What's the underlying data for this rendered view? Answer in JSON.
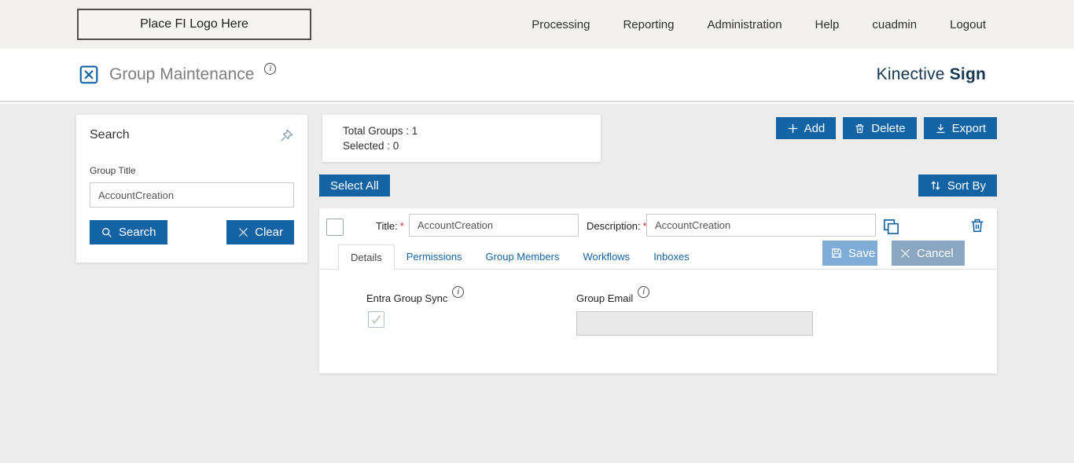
{
  "topbar": {
    "logo_placeholder": "Place FI Logo Here",
    "nav": [
      "Processing",
      "Reporting",
      "Administration",
      "Help",
      "cuadmin",
      "Logout"
    ]
  },
  "header": {
    "title": "Group Maintenance",
    "info_glyph": "i",
    "brand_primary": "Kinective",
    "brand_bold": "Sign"
  },
  "search_panel": {
    "title": "Search",
    "group_title_label": "Group Title",
    "group_title_value": "AccountCreation",
    "search_button": "Search",
    "clear_button": "Clear"
  },
  "summary": {
    "total_groups": "Total Groups : 1",
    "selected": "Selected : 0"
  },
  "toolbar": {
    "add": "Add",
    "delete": "Delete",
    "export": "Export",
    "select_all": "Select All",
    "sort_by": "Sort By"
  },
  "group_editor": {
    "title_label": "Title:",
    "title_value": "AccountCreation",
    "description_label": "Description:",
    "description_value": "AccountCreation",
    "required_marker": "*",
    "tabs": [
      "Details",
      "Permissions",
      "Group Members",
      "Workflows",
      "Inboxes"
    ],
    "save": "Save",
    "cancel": "Cancel",
    "details": {
      "entra_label": "Entra Group Sync",
      "email_label": "Group Email",
      "email_value": ""
    }
  },
  "icons": {
    "page": "x-document-icon",
    "pin": "pushpin-icon",
    "search": "magnifier-icon",
    "clear": "x-icon",
    "add": "plus-icon",
    "delete": "trash-icon",
    "export": "download-icon",
    "sort": "up-down-arrows-icon",
    "copy": "copy-icon",
    "save": "floppy-disk-icon",
    "cancel": "x-icon",
    "check": "checkmark-icon",
    "info": "info-circle-icon"
  },
  "colors": {
    "primary_blue": "#1363a5",
    "save_muted": "#7fadd8",
    "cancel_muted": "#8aa6c1",
    "brand_navy": "#14374f",
    "required_red": "#d22a2a",
    "content_bg": "#ececec"
  }
}
